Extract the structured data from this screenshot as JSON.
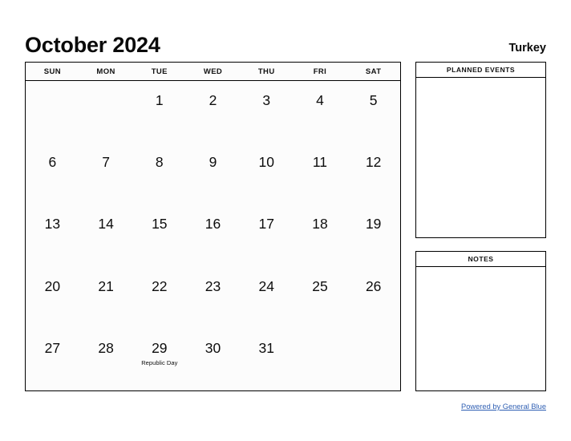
{
  "header": {
    "month_title": "October 2024",
    "country": "Turkey"
  },
  "calendar": {
    "weekdays": [
      "SUN",
      "MON",
      "TUE",
      "WED",
      "THU",
      "FRI",
      "SAT"
    ],
    "weeks": [
      [
        {
          "day": "",
          "event": ""
        },
        {
          "day": "",
          "event": ""
        },
        {
          "day": "1",
          "event": ""
        },
        {
          "day": "2",
          "event": ""
        },
        {
          "day": "3",
          "event": ""
        },
        {
          "day": "4",
          "event": ""
        },
        {
          "day": "5",
          "event": ""
        }
      ],
      [
        {
          "day": "6",
          "event": ""
        },
        {
          "day": "7",
          "event": ""
        },
        {
          "day": "8",
          "event": ""
        },
        {
          "day": "9",
          "event": ""
        },
        {
          "day": "10",
          "event": ""
        },
        {
          "day": "11",
          "event": ""
        },
        {
          "day": "12",
          "event": ""
        }
      ],
      [
        {
          "day": "13",
          "event": ""
        },
        {
          "day": "14",
          "event": ""
        },
        {
          "day": "15",
          "event": ""
        },
        {
          "day": "16",
          "event": ""
        },
        {
          "day": "17",
          "event": ""
        },
        {
          "day": "18",
          "event": ""
        },
        {
          "day": "19",
          "event": ""
        }
      ],
      [
        {
          "day": "20",
          "event": ""
        },
        {
          "day": "21",
          "event": ""
        },
        {
          "day": "22",
          "event": ""
        },
        {
          "day": "23",
          "event": ""
        },
        {
          "day": "24",
          "event": ""
        },
        {
          "day": "25",
          "event": ""
        },
        {
          "day": "26",
          "event": ""
        }
      ],
      [
        {
          "day": "27",
          "event": ""
        },
        {
          "day": "28",
          "event": ""
        },
        {
          "day": "29",
          "event": "Republic Day"
        },
        {
          "day": "30",
          "event": ""
        },
        {
          "day": "31",
          "event": ""
        },
        {
          "day": "",
          "event": ""
        },
        {
          "day": "",
          "event": ""
        }
      ]
    ]
  },
  "panels": {
    "events_title": "PLANNED EVENTS",
    "events_body": "",
    "notes_title": "NOTES",
    "notes_body": ""
  },
  "footer": {
    "link_text": "Powered by General Blue",
    "link_color": "#2f5fb3"
  }
}
